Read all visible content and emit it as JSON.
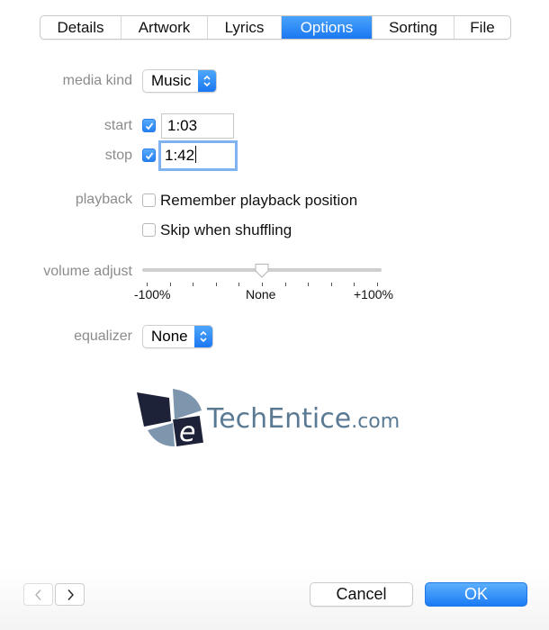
{
  "tabs": [
    {
      "label": "Details",
      "active": false
    },
    {
      "label": "Artwork",
      "active": false
    },
    {
      "label": "Lyrics",
      "active": false
    },
    {
      "label": "Options",
      "active": true
    },
    {
      "label": "Sorting",
      "active": false
    },
    {
      "label": "File",
      "active": false
    }
  ],
  "media_kind": {
    "label": "media kind",
    "value": "Music"
  },
  "start": {
    "label": "start",
    "checked": true,
    "value": "1:03"
  },
  "stop": {
    "label": "stop",
    "checked": true,
    "value": "1:42"
  },
  "playback": {
    "label": "playback",
    "options": [
      {
        "label": "Remember playback position",
        "checked": false
      },
      {
        "label": "Skip when shuffling",
        "checked": false
      }
    ]
  },
  "volume_adjust": {
    "label": "volume adjust",
    "value_percent": 0,
    "min_label": "-100%",
    "mid_label": "None",
    "max_label": "+100%",
    "tick_count": 11
  },
  "equalizer": {
    "label": "equalizer",
    "value": "None"
  },
  "watermark": {
    "text": "TechEntice",
    "suffix": ".com",
    "letter": "e"
  },
  "footer": {
    "prev_icon": "chevron-left-icon",
    "next_icon": "chevron-right-icon",
    "cancel_label": "Cancel",
    "ok_label": "OK"
  },
  "colors": {
    "accent": "#1b78f2",
    "label_gray": "#8c8c8c",
    "logo_blue": "#5a7a94"
  }
}
